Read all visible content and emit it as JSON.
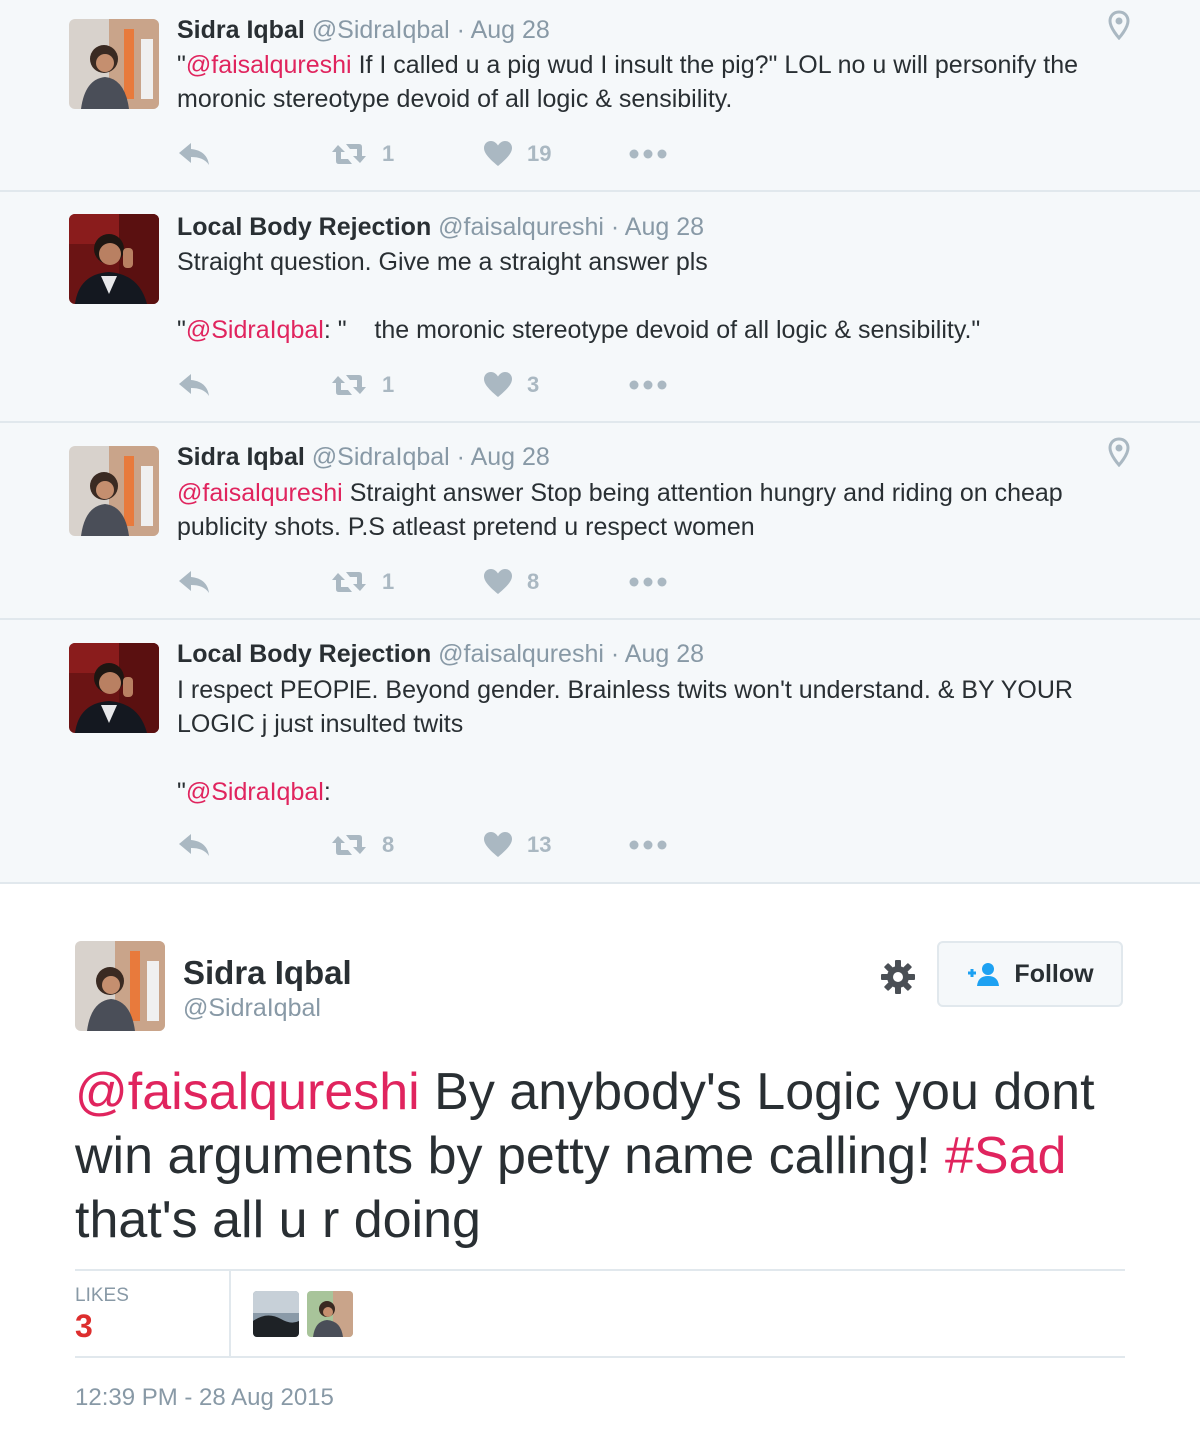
{
  "colors": {
    "mention": "#e0245e",
    "muted": "#8899a6",
    "action_icon": "#aab8c2",
    "thread_bg": "#f5f8fa",
    "likes_accent": "#dd2e2e"
  },
  "thread": [
    {
      "name": "Sidra Iqbal",
      "handle": "@SidraIqbal",
      "sep": "·",
      "date": "Aug 28",
      "has_location": true,
      "text_mention": "@faisalqureshi",
      "text_prefix": "\"",
      "text_rest": " If I called u a pig wud I insult the pig?\" LOL no u will personify the moronic stereotype devoid of all logic & sensibility.",
      "retweets": "1",
      "likes": "19"
    },
    {
      "name": "Local Body Rejection",
      "handle": "@faisalqureshi",
      "sep": "·",
      "date": "Aug 28",
      "has_location": false,
      "text_line1": "Straight question. Give me a straight answer pls",
      "quote_open": "\"",
      "quote_mention": "@SidraIqbal",
      "quote_rest": ": \"    the moronic stereotype devoid of all logic & sensibility.\"",
      "retweets": "1",
      "likes": "3"
    },
    {
      "name": "Sidra Iqbal",
      "handle": "@SidraIqbal",
      "sep": "·",
      "date": "Aug 28",
      "has_location": true,
      "text_mention": "@faisalqureshi",
      "text_rest": " Straight answer Stop being attention hungry and riding on cheap publicity shots. P.S atleast pretend u respect women",
      "retweets": "1",
      "likes": "8"
    },
    {
      "name": "Local Body Rejection",
      "handle": "@faisalqureshi",
      "sep": "·",
      "date": "Aug 28",
      "has_location": false,
      "text_line1": "I respect PEOPlE. Beyond gender. Brainless twits won't understand. & BY YOUR LOGIC j just insulted twits",
      "quote_open": "\"",
      "quote_mention": "@SidraIqbal",
      "quote_rest": ":",
      "retweets": "8",
      "likes": "13"
    }
  ],
  "main_tweet": {
    "name": "Sidra Iqbal",
    "handle": "@SidraIqbal",
    "follow_label": "Follow",
    "text_mention": "@faisalqureshi",
    "text_middle": " By anybody's Logic you dont win arguments by petty name calling! ",
    "hashtag": "#Sad",
    "text_end": " that's all u r doing",
    "likes_label": "LIKES",
    "likes_count": "3",
    "timestamp": "12:39 PM - 28 Aug 2015"
  },
  "icons": {
    "reply": "reply-icon",
    "retweet": "retweet-icon",
    "like": "heart-icon",
    "more": "more-dots-icon",
    "location": "location-pin-icon",
    "settings": "gear-icon",
    "follow": "add-user-icon"
  }
}
